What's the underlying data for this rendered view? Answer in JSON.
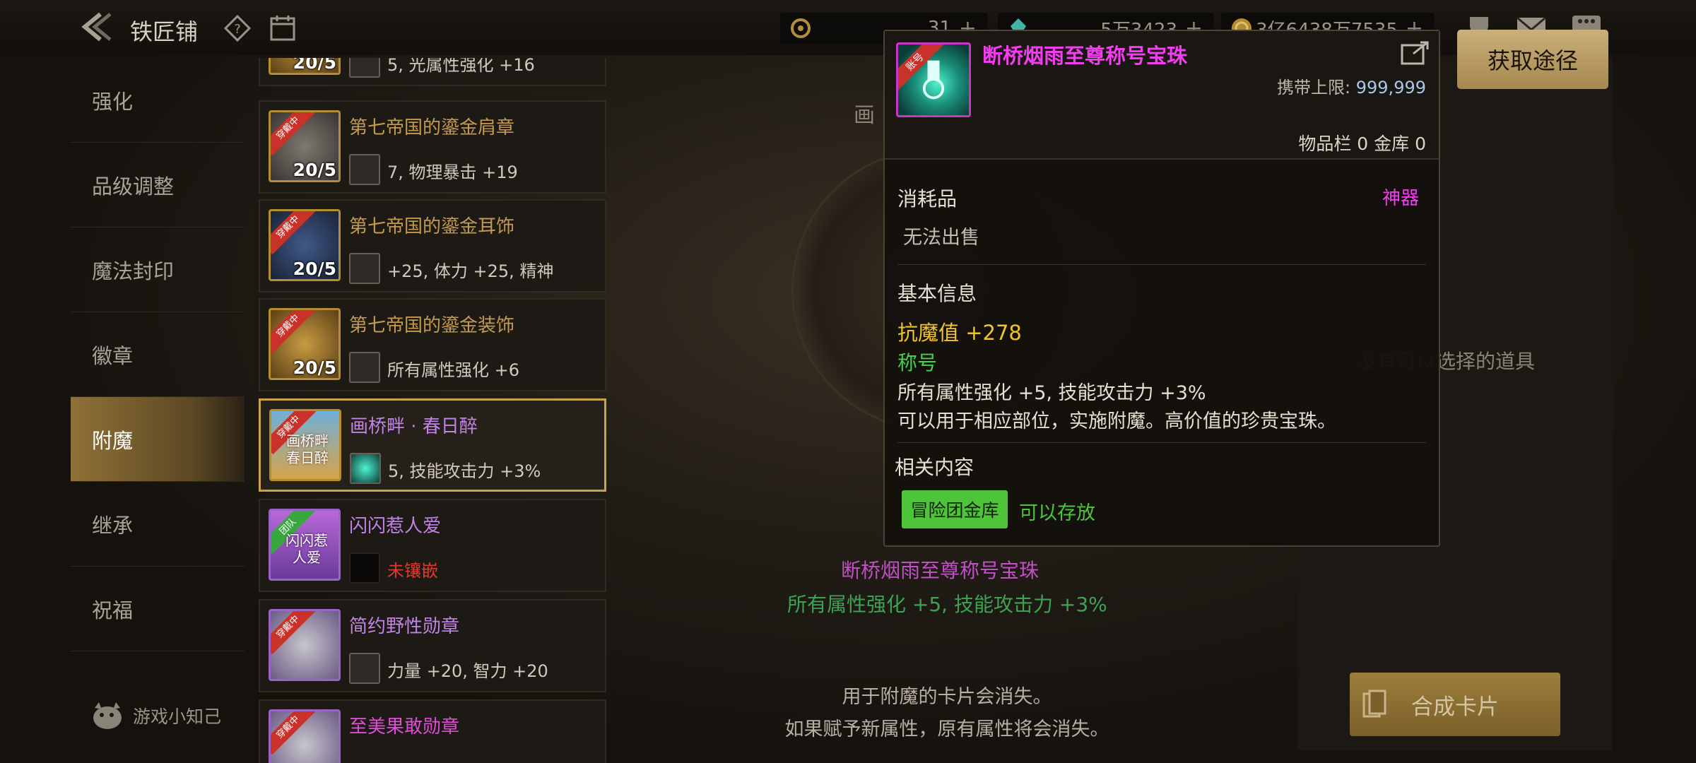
{
  "header": {
    "title": "铁匠铺",
    "currencies": [
      {
        "icon": "gold-c-icon",
        "amount": "31"
      },
      {
        "icon": "crystal-icon",
        "amount": "5万3423"
      },
      {
        "icon": "coin-icon",
        "amount": "3亿6438万7535"
      }
    ]
  },
  "nav": {
    "items": [
      {
        "label": "强化"
      },
      {
        "label": "品级调整"
      },
      {
        "label": "魔法封印"
      },
      {
        "label": "徽章"
      },
      {
        "label": "附魔"
      },
      {
        "label": "继承"
      },
      {
        "label": "祝福"
      }
    ],
    "active_index": 4,
    "tips_label": "游戏小知己"
  },
  "items": [
    {
      "name": "",
      "count": "20/5",
      "ribbon": "",
      "sub": "5, 光属性强化 +16"
    },
    {
      "name": "第七帝国的鎏金肩章",
      "count": "20/5",
      "ribbon": "穿戴中",
      "sub": "7, 物理暴击 +19"
    },
    {
      "name": "第七帝国的鎏金耳饰",
      "count": "20/5",
      "ribbon": "穿戴中",
      "sub": "+25, 体力 +25, 精神"
    },
    {
      "name": "第七帝国的鎏金装饰",
      "count": "20/5",
      "ribbon": "穿戴中",
      "sub": "所有属性强化 +6"
    },
    {
      "name": "画桥畔 · 春日醉",
      "count": "",
      "ribbon": "穿戴中",
      "sub": "5, 技能攻击力 +3%",
      "thumb_text": "画桥畔 春日醉"
    },
    {
      "name": "闪闪惹人爱",
      "count": "",
      "ribbon": "团队",
      "sub": "未镶嵌",
      "thumb_text": "闪闪惹 人爱"
    },
    {
      "name": "简约野性勋章",
      "count": "",
      "ribbon": "穿戴中",
      "sub": "力量 +20, 智力 +20"
    },
    {
      "name": "至美果敢勋章",
      "count": "",
      "ribbon": "穿戴中",
      "sub": ""
    }
  ],
  "center": {
    "label": "画",
    "result_name": "断桥烟雨至尊称号宝珠",
    "result_stat": "所有属性强化 +5, 技能攻击力 +3%",
    "note_line1": "用于附魔的卡片会消失。",
    "note_line2": "如果赋予新属性，原有属性将会消失。"
  },
  "right": {
    "acquire_label": "获取途径",
    "empty_text": "没有可以选择的道具",
    "compose_label": "合成卡片"
  },
  "tooltip": {
    "ribbon": "账号",
    "title": "断桥烟雨至尊称号宝珠",
    "limit_label": "携带上限:",
    "limit_value": "999,999",
    "inventory": "物品栏 0 金库 0",
    "type": "消耗品",
    "rarity": "神器",
    "sell": "无法出售",
    "basic_label": "基本信息",
    "resist": "抗魔值 +278",
    "title_label": "称号",
    "stat": "所有属性强化 +5, 技能攻击力 +3%",
    "desc": "可以用于相应部位，实施附魔。高价值的珍贵宝珠。",
    "related_label": "相关内容",
    "tag": "冒险团金库",
    "store_text": "可以存放"
  },
  "colors": {
    "rarity_magenta": "#f23ef0",
    "resist_yellow": "#f2c42b",
    "green": "#45d14b",
    "gold_button": "#cbb07a"
  }
}
